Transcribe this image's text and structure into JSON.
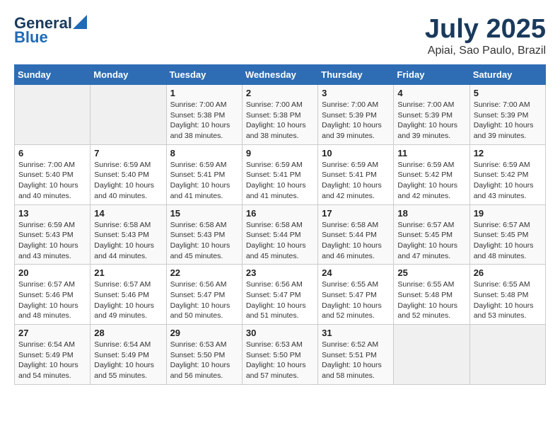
{
  "header": {
    "logo_line1": "General",
    "logo_line2": "Blue",
    "title": "July 2025",
    "subtitle": "Apiai, Sao Paulo, Brazil"
  },
  "weekdays": [
    "Sunday",
    "Monday",
    "Tuesday",
    "Wednesday",
    "Thursday",
    "Friday",
    "Saturday"
  ],
  "weeks": [
    [
      {
        "day": "",
        "info": ""
      },
      {
        "day": "",
        "info": ""
      },
      {
        "day": "1",
        "info": "Sunrise: 7:00 AM\nSunset: 5:38 PM\nDaylight: 10 hours and 38 minutes."
      },
      {
        "day": "2",
        "info": "Sunrise: 7:00 AM\nSunset: 5:38 PM\nDaylight: 10 hours and 38 minutes."
      },
      {
        "day": "3",
        "info": "Sunrise: 7:00 AM\nSunset: 5:39 PM\nDaylight: 10 hours and 39 minutes."
      },
      {
        "day": "4",
        "info": "Sunrise: 7:00 AM\nSunset: 5:39 PM\nDaylight: 10 hours and 39 minutes."
      },
      {
        "day": "5",
        "info": "Sunrise: 7:00 AM\nSunset: 5:39 PM\nDaylight: 10 hours and 39 minutes."
      }
    ],
    [
      {
        "day": "6",
        "info": "Sunrise: 7:00 AM\nSunset: 5:40 PM\nDaylight: 10 hours and 40 minutes."
      },
      {
        "day": "7",
        "info": "Sunrise: 6:59 AM\nSunset: 5:40 PM\nDaylight: 10 hours and 40 minutes."
      },
      {
        "day": "8",
        "info": "Sunrise: 6:59 AM\nSunset: 5:41 PM\nDaylight: 10 hours and 41 minutes."
      },
      {
        "day": "9",
        "info": "Sunrise: 6:59 AM\nSunset: 5:41 PM\nDaylight: 10 hours and 41 minutes."
      },
      {
        "day": "10",
        "info": "Sunrise: 6:59 AM\nSunset: 5:41 PM\nDaylight: 10 hours and 42 minutes."
      },
      {
        "day": "11",
        "info": "Sunrise: 6:59 AM\nSunset: 5:42 PM\nDaylight: 10 hours and 42 minutes."
      },
      {
        "day": "12",
        "info": "Sunrise: 6:59 AM\nSunset: 5:42 PM\nDaylight: 10 hours and 43 minutes."
      }
    ],
    [
      {
        "day": "13",
        "info": "Sunrise: 6:59 AM\nSunset: 5:43 PM\nDaylight: 10 hours and 43 minutes."
      },
      {
        "day": "14",
        "info": "Sunrise: 6:58 AM\nSunset: 5:43 PM\nDaylight: 10 hours and 44 minutes."
      },
      {
        "day": "15",
        "info": "Sunrise: 6:58 AM\nSunset: 5:43 PM\nDaylight: 10 hours and 45 minutes."
      },
      {
        "day": "16",
        "info": "Sunrise: 6:58 AM\nSunset: 5:44 PM\nDaylight: 10 hours and 45 minutes."
      },
      {
        "day": "17",
        "info": "Sunrise: 6:58 AM\nSunset: 5:44 PM\nDaylight: 10 hours and 46 minutes."
      },
      {
        "day": "18",
        "info": "Sunrise: 6:57 AM\nSunset: 5:45 PM\nDaylight: 10 hours and 47 minutes."
      },
      {
        "day": "19",
        "info": "Sunrise: 6:57 AM\nSunset: 5:45 PM\nDaylight: 10 hours and 48 minutes."
      }
    ],
    [
      {
        "day": "20",
        "info": "Sunrise: 6:57 AM\nSunset: 5:46 PM\nDaylight: 10 hours and 48 minutes."
      },
      {
        "day": "21",
        "info": "Sunrise: 6:57 AM\nSunset: 5:46 PM\nDaylight: 10 hours and 49 minutes."
      },
      {
        "day": "22",
        "info": "Sunrise: 6:56 AM\nSunset: 5:47 PM\nDaylight: 10 hours and 50 minutes."
      },
      {
        "day": "23",
        "info": "Sunrise: 6:56 AM\nSunset: 5:47 PM\nDaylight: 10 hours and 51 minutes."
      },
      {
        "day": "24",
        "info": "Sunrise: 6:55 AM\nSunset: 5:47 PM\nDaylight: 10 hours and 52 minutes."
      },
      {
        "day": "25",
        "info": "Sunrise: 6:55 AM\nSunset: 5:48 PM\nDaylight: 10 hours and 52 minutes."
      },
      {
        "day": "26",
        "info": "Sunrise: 6:55 AM\nSunset: 5:48 PM\nDaylight: 10 hours and 53 minutes."
      }
    ],
    [
      {
        "day": "27",
        "info": "Sunrise: 6:54 AM\nSunset: 5:49 PM\nDaylight: 10 hours and 54 minutes."
      },
      {
        "day": "28",
        "info": "Sunrise: 6:54 AM\nSunset: 5:49 PM\nDaylight: 10 hours and 55 minutes."
      },
      {
        "day": "29",
        "info": "Sunrise: 6:53 AM\nSunset: 5:50 PM\nDaylight: 10 hours and 56 minutes."
      },
      {
        "day": "30",
        "info": "Sunrise: 6:53 AM\nSunset: 5:50 PM\nDaylight: 10 hours and 57 minutes."
      },
      {
        "day": "31",
        "info": "Sunrise: 6:52 AM\nSunset: 5:51 PM\nDaylight: 10 hours and 58 minutes."
      },
      {
        "day": "",
        "info": ""
      },
      {
        "day": "",
        "info": ""
      }
    ]
  ]
}
